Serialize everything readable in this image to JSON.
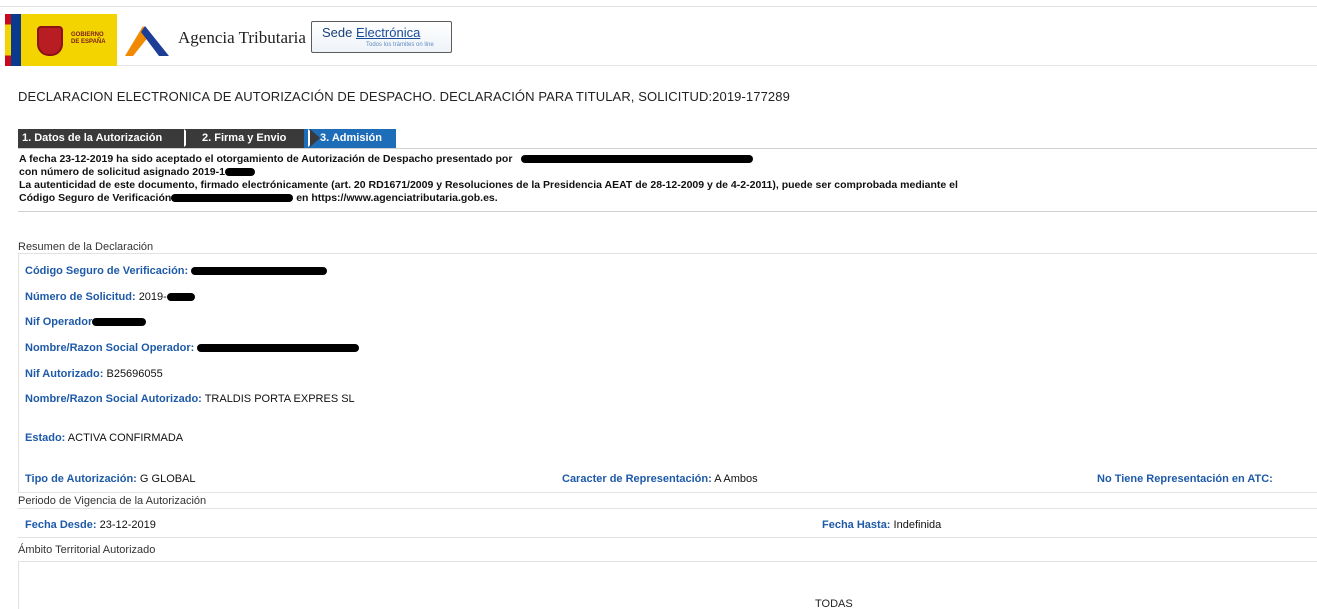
{
  "header": {
    "gov_logo_text": "GOBIERNO DE ESPAÑA",
    "agency_name": "Agencia Tributaria",
    "sede_title_1": "Sede",
    "sede_title_2": "Electrónica",
    "sede_sub": "Todos los trámites on line"
  },
  "page_title": "DECLARACION ELECTRONICA DE AUTORIZACIÓN DE DESPACHO. DECLARACIÓN PARA TITULAR, SOLICITUD:2019-177289",
  "steps": [
    {
      "label": "1. Datos de la Autorización",
      "active": false
    },
    {
      "label": "2. Firma y Envio",
      "active": false
    },
    {
      "label": "3. Admisión",
      "active": true
    }
  ],
  "info": {
    "line1": "A fecha 23-12-2019 ha sido aceptado el otorgamiento de Autorización de Despacho presentado por",
    "line2": "con número de solicitud asignado 2019-1",
    "line3": "La autenticidad de este documento, firmado electrónicamente (art. 20 RD1671/2009 y Resoluciones de la Presidencia AEAT de 28-12-2009 y de 4-2-2011), puede ser comprobada mediante el",
    "line4a": "Código Seguro de Verificación",
    "line4b": "en https://www.agenciatributaria.gob.es."
  },
  "resumen": {
    "section_title": "Resumen de la Declaración",
    "csv_label": "Código Seguro de Verificación:",
    "num_solicitud_label": "Número de Solicitud:",
    "num_solicitud_value": "2019-",
    "nif_operador_label": "Nif Operador",
    "nombre_operador_label": "Nombre/Razon Social Operador:",
    "nif_autorizado_label": "Nif Autorizado:",
    "nif_autorizado_value": "B25696055",
    "nombre_autorizado_label": "Nombre/Razon Social Autorizado:",
    "nombre_autorizado_value": "TRALDIS PORTA EXPRES SL",
    "estado_label": "Estado:",
    "estado_value": "ACTIVA CONFIRMADA",
    "tipo_label": "Tipo de Autorización:",
    "tipo_value": "G GLOBAL",
    "caracter_label": "Caracter de Representación:",
    "caracter_value": "A Ambos",
    "no_tiene_label": "No Tiene Representación en ATC:"
  },
  "vigencia": {
    "section_title": "Periodo de Vigencia de la Autorización",
    "desde_label": "Fecha Desde:",
    "desde_value": "23-12-2019",
    "hasta_label": "Fecha Hasta:",
    "hasta_value": "Indefinida"
  },
  "ambito": {
    "section_title": "Ámbito Territorial Autorizado",
    "value": "TODAS"
  },
  "colors": {
    "label_blue": "#1e5aa8",
    "step_dark": "#3a3a3a",
    "step_active": "#1d6db8",
    "logo_yellow": "#f4d400"
  }
}
